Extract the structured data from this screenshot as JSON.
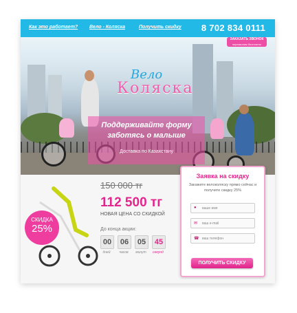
{
  "nav": {
    "links": [
      "Как это работает?",
      "Вело - Коляска",
      "Получить скидку"
    ],
    "phone": "8 702 834 0111",
    "call_button": "ЗАКАЗАТЬ ЗВОНОК",
    "call_button_sub": "перезвоним бесплатно"
  },
  "hero": {
    "logo_line1": "Вело",
    "logo_line2": "Коляска",
    "headline1": "Поддерживайте форму",
    "headline2": "заботясь о малыше",
    "delivery": "Доставка по Казахстану"
  },
  "offer": {
    "badge_top": "СКИДКА",
    "badge_pct": "25%",
    "old_price": "150 000 тг",
    "new_price": "112 500 тг",
    "new_label": "НОВАЯ ЦЕНА СО СКИДКОЙ",
    "countdown_label": "До конца акции:",
    "countdown": [
      {
        "value": "00",
        "label": "дней"
      },
      {
        "value": "06",
        "label": "часов"
      },
      {
        "value": "05",
        "label": "минут"
      },
      {
        "value": "45",
        "label": "секунд"
      }
    ]
  },
  "form": {
    "title": "Заявка на скидку",
    "subtitle": "Закажите велоколяску прямо сейчас и получите скидку 25%",
    "name_placeholder": "ваше имя",
    "email_placeholder": "ваш e-mail",
    "phone_placeholder": "ваш телефон",
    "submit": "ПОЛУЧИТЬ СКИДКУ"
  },
  "colors": {
    "accent": "#e4258e",
    "nav": "#22b9e6"
  }
}
